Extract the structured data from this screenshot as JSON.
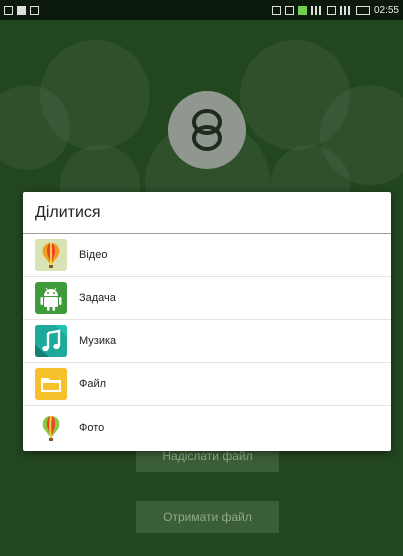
{
  "status_bar": {
    "time": "02:55"
  },
  "background": {
    "send_button_label": "Надіслати файл",
    "receive_button_label": "Отримати файл"
  },
  "dialog": {
    "title": "Ділитися",
    "items": [
      {
        "label": "Відео",
        "icon": "gallery-balloon-icon"
      },
      {
        "label": "Задача",
        "icon": "android-icon"
      },
      {
        "label": "Музика",
        "icon": "music-note-icon"
      },
      {
        "label": "Файл",
        "icon": "folder-icon"
      },
      {
        "label": "Фото",
        "icon": "gallery-balloon-icon"
      }
    ]
  },
  "colors": {
    "background_green": "#22461f",
    "android_green": "#3f9a3b",
    "music_teal": "#1aa99a",
    "folder_yellow": "#f6c12a"
  }
}
